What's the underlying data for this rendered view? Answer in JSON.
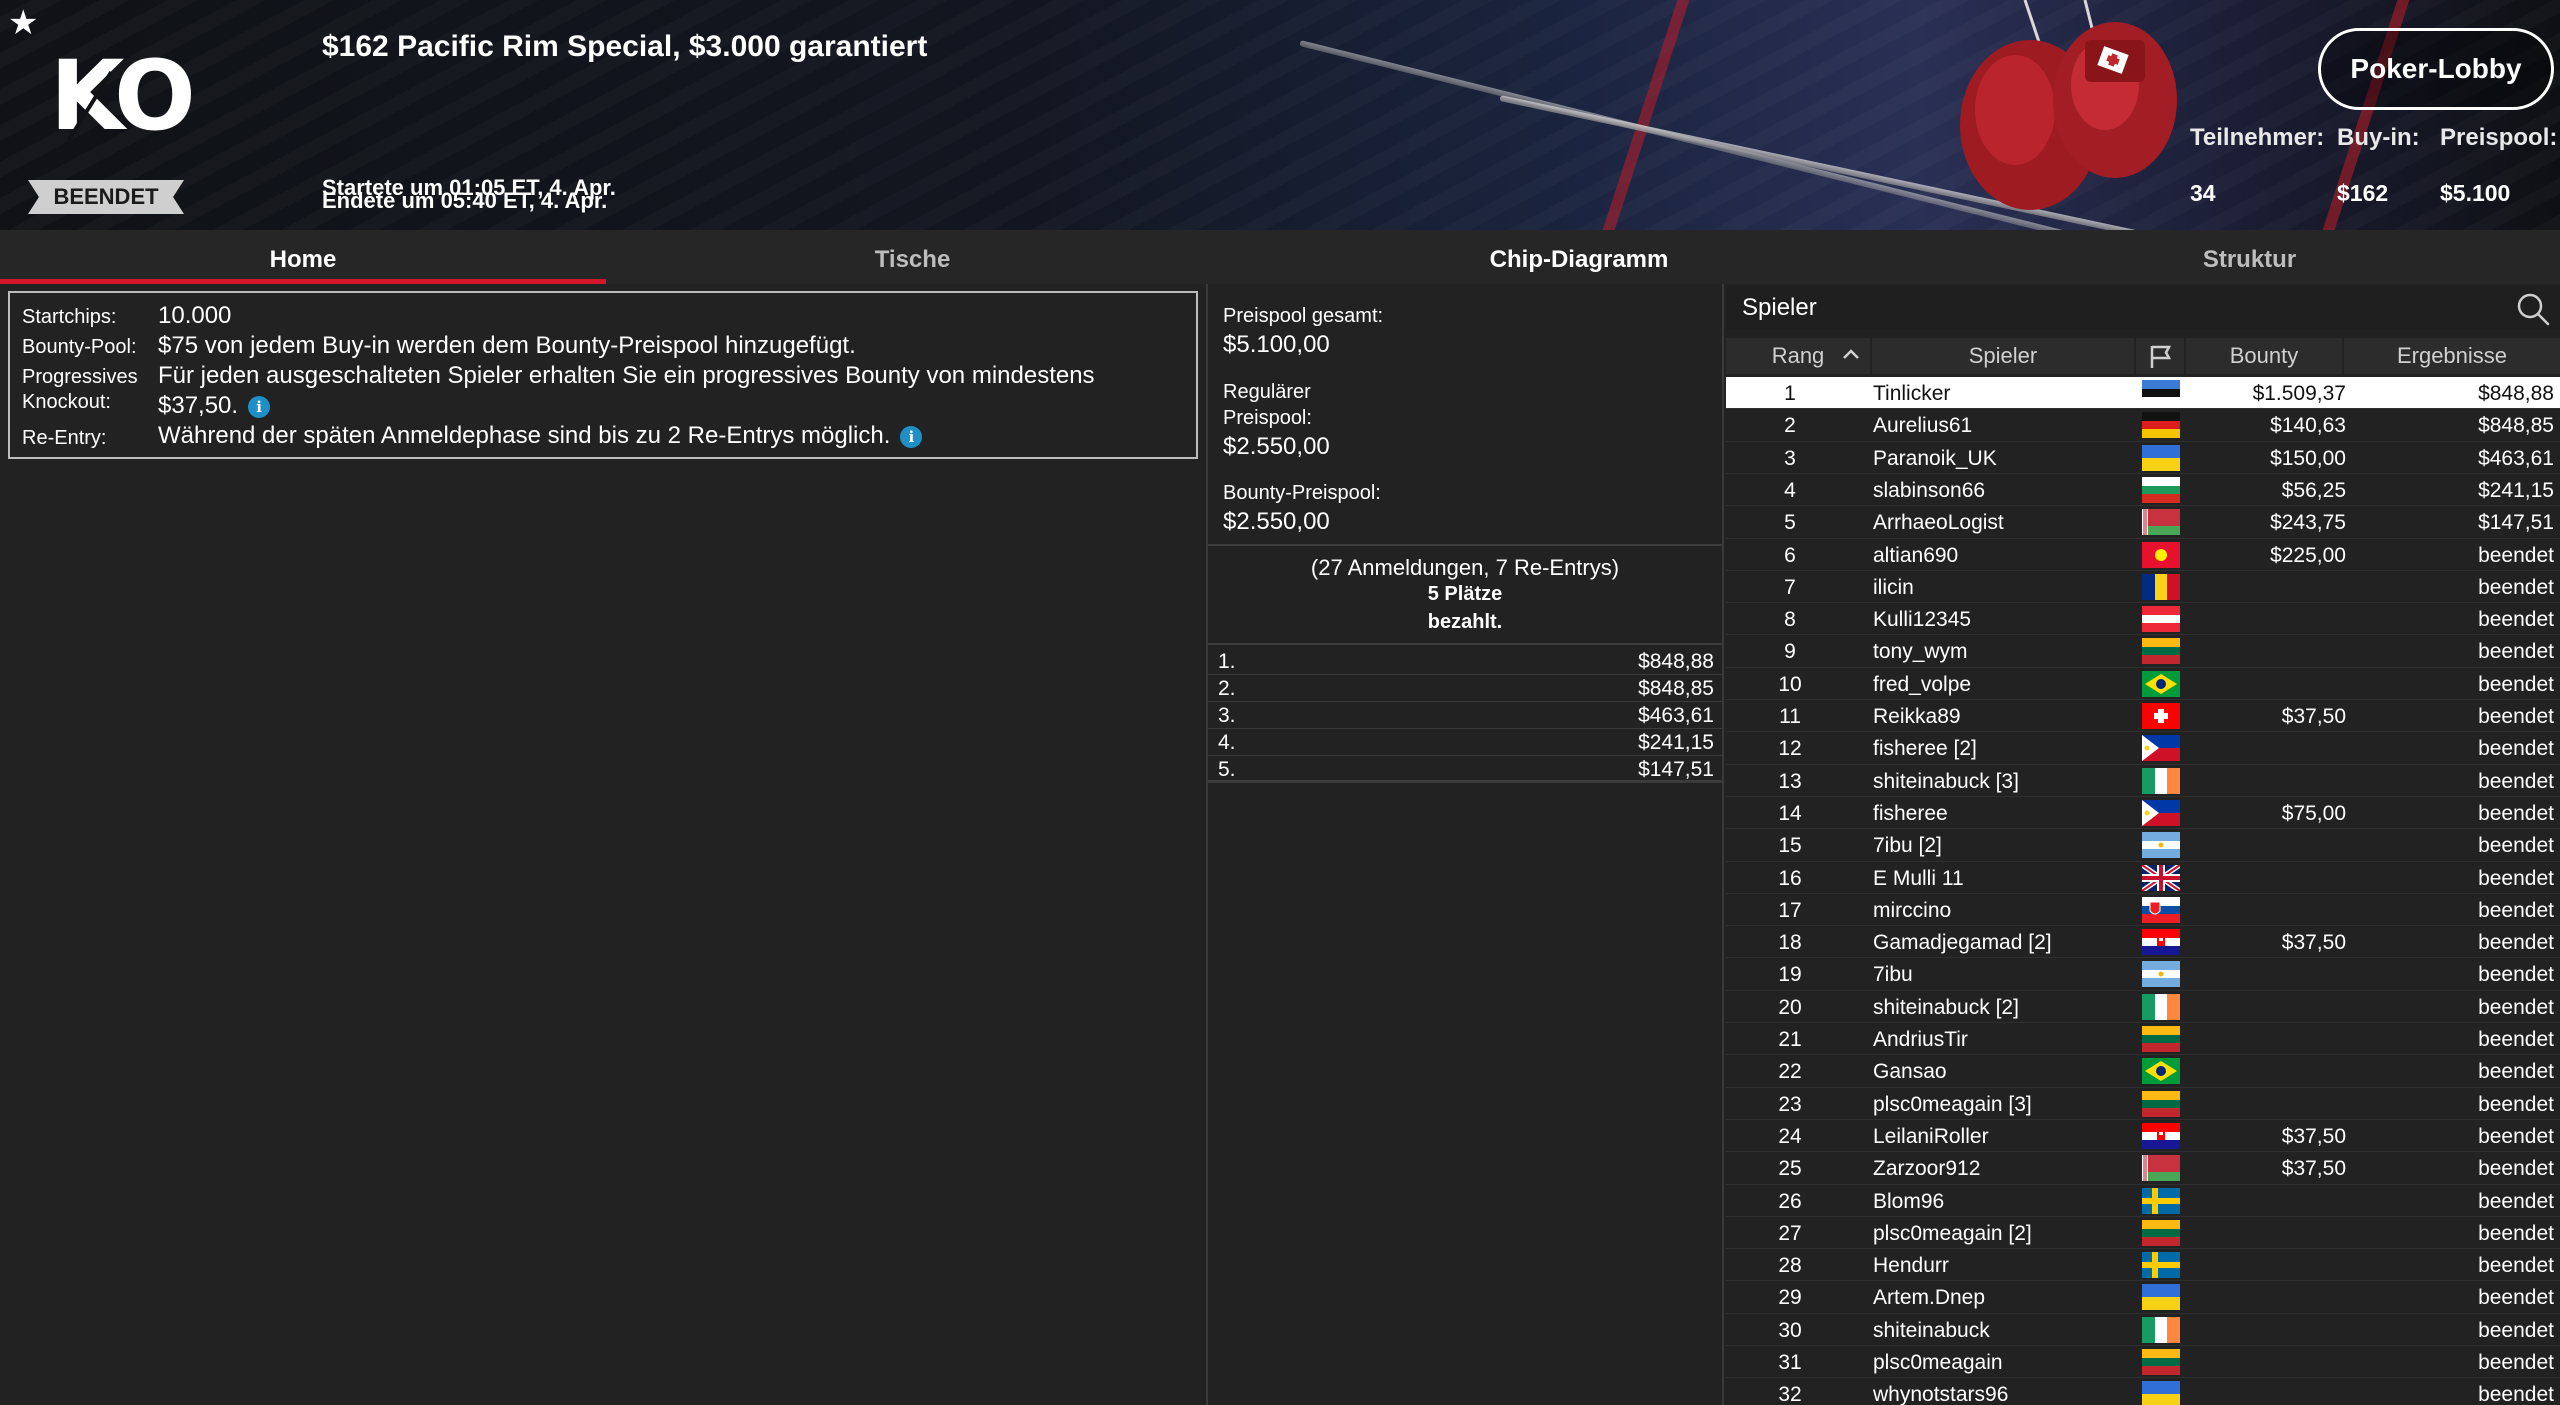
{
  "header": {
    "title": "$162 Pacific Rim Special, $3.000 garantiert",
    "logo": "KO",
    "status": "BEENDET",
    "started": "Startete um 01:05 ET, 4. Apr.",
    "ended": "Endete um 05:40 ET, 4. Apr.",
    "lobby_button": "Poker-Lobby",
    "stats": [
      {
        "label": "Teilnehmer:",
        "value": "34"
      },
      {
        "label": "Buy-in:",
        "value": "$162"
      },
      {
        "label": "Preispool:",
        "value": "$5.100"
      }
    ]
  },
  "tabs": [
    "Home",
    "Tische",
    "Chip-Diagramm",
    "Struktur"
  ],
  "info": {
    "startchips_label": "Startchips:",
    "startchips_value": "10.000",
    "bounty_label": "Bounty-Pool:",
    "bounty_value": "$75 von jedem Buy-in werden dem Bounty-Preispool hinzugefügt.",
    "progressive_label1": "Progressives",
    "progressive_label2": "Knockout:",
    "progressive_value1": "Für jeden ausgeschalteten Spieler erhalten Sie ein progressives Bounty von mindestens",
    "progressive_value2": "$37,50.",
    "reentry_label": "Re-Entry:",
    "reentry_value": "Während der späten Anmeldephase sind bis zu 2 Re-Entrys möglich.",
    "info_icon_glyph": "i"
  },
  "prize": {
    "total_label": "Preispool gesamt:",
    "total_value": "$5.100,00",
    "regular_label1": "Regulärer",
    "regular_label2": "Preispool:",
    "regular_value": "$2.550,00",
    "bounty_label": "Bounty-Preispool:",
    "bounty_value": "$2.550,00",
    "entries": "(27 Anmeldungen, 7 Re-Entrys)",
    "paid1": "5 Plätze",
    "paid2": "bezahlt.",
    "payouts": [
      {
        "place": "1.",
        "amount": "$848,88"
      },
      {
        "place": "2.",
        "amount": "$848,85"
      },
      {
        "place": "3.",
        "amount": "$463,61"
      },
      {
        "place": "4.",
        "amount": "$241,15"
      },
      {
        "place": "5.",
        "amount": "$147,51"
      }
    ]
  },
  "players": {
    "title": "Spieler",
    "columns": {
      "rank": "Rang",
      "player": "Spieler",
      "bounty": "Bounty",
      "result": "Ergebnisse"
    },
    "rows": [
      {
        "rank": "1",
        "name": "Tinlicker",
        "flag": "EE",
        "bounty": "$1.509,37",
        "result": "$848,88"
      },
      {
        "rank": "2",
        "name": "Aurelius61",
        "flag": "DE",
        "bounty": "$140,63",
        "result": "$848,85"
      },
      {
        "rank": "3",
        "name": "Paranoik_UK",
        "flag": "UA",
        "bounty": "$150,00",
        "result": "$463,61"
      },
      {
        "rank": "4",
        "name": "slabinson66",
        "flag": "BG",
        "bounty": "$56,25",
        "result": "$241,15"
      },
      {
        "rank": "5",
        "name": "ArrhaeoLogist",
        "flag": "BY",
        "bounty": "$243,75",
        "result": "$147,51"
      },
      {
        "rank": "6",
        "name": "altian690",
        "flag": "KG",
        "bounty": "$225,00",
        "result": "beendet"
      },
      {
        "rank": "7",
        "name": "ilicin",
        "flag": "RO",
        "bounty": "",
        "result": "beendet"
      },
      {
        "rank": "8",
        "name": "Kulli12345",
        "flag": "AT",
        "bounty": "",
        "result": "beendet"
      },
      {
        "rank": "9",
        "name": "tony_wym",
        "flag": "LT",
        "bounty": "",
        "result": "beendet"
      },
      {
        "rank": "10",
        "name": "fred_volpe",
        "flag": "BR",
        "bounty": "",
        "result": "beendet"
      },
      {
        "rank": "11",
        "name": "Reikka89",
        "flag": "CH",
        "bounty": "$37,50",
        "result": "beendet"
      },
      {
        "rank": "12",
        "name": "fisheree [2]",
        "flag": "PH",
        "bounty": "",
        "result": "beendet"
      },
      {
        "rank": "13",
        "name": "shiteinabuck [3]",
        "flag": "IE",
        "bounty": "",
        "result": "beendet"
      },
      {
        "rank": "14",
        "name": "fisheree",
        "flag": "PH",
        "bounty": "$75,00",
        "result": "beendet"
      },
      {
        "rank": "15",
        "name": "7ibu [2]",
        "flag": "AR",
        "bounty": "",
        "result": "beendet"
      },
      {
        "rank": "16",
        "name": "E Mulli 11",
        "flag": "GB",
        "bounty": "",
        "result": "beendet"
      },
      {
        "rank": "17",
        "name": "mirccino",
        "flag": "SK",
        "bounty": "",
        "result": "beendet"
      },
      {
        "rank": "18",
        "name": "Gamadjegamad [2]",
        "flag": "HR",
        "bounty": "$37,50",
        "result": "beendet"
      },
      {
        "rank": "19",
        "name": "7ibu",
        "flag": "AR",
        "bounty": "",
        "result": "beendet"
      },
      {
        "rank": "20",
        "name": "shiteinabuck [2]",
        "flag": "IE",
        "bounty": "",
        "result": "beendet"
      },
      {
        "rank": "21",
        "name": "AndriusTir",
        "flag": "LT",
        "bounty": "",
        "result": "beendet"
      },
      {
        "rank": "22",
        "name": "Gansao",
        "flag": "BR",
        "bounty": "",
        "result": "beendet"
      },
      {
        "rank": "23",
        "name": "plsc0meagain [3]",
        "flag": "LT",
        "bounty": "",
        "result": "beendet"
      },
      {
        "rank": "24",
        "name": "LeilaniRoller",
        "flag": "HR",
        "bounty": "$37,50",
        "result": "beendet"
      },
      {
        "rank": "25",
        "name": "Zarzoor912",
        "flag": "BY",
        "bounty": "$37,50",
        "result": "beendet"
      },
      {
        "rank": "26",
        "name": "Blom96",
        "flag": "SE",
        "bounty": "",
        "result": "beendet"
      },
      {
        "rank": "27",
        "name": "plsc0meagain [2]",
        "flag": "LT",
        "bounty": "",
        "result": "beendet"
      },
      {
        "rank": "28",
        "name": "Hendurr",
        "flag": "SE",
        "bounty": "",
        "result": "beendet"
      },
      {
        "rank": "29",
        "name": "Artem.Dnep",
        "flag": "UA",
        "bounty": "",
        "result": "beendet"
      },
      {
        "rank": "30",
        "name": "shiteinabuck",
        "flag": "IE",
        "bounty": "",
        "result": "beendet"
      },
      {
        "rank": "31",
        "name": "plsc0meagain",
        "flag": "LT",
        "bounty": "",
        "result": "beendet"
      },
      {
        "rank": "32",
        "name": "whynotstars96",
        "flag": "UA",
        "bounty": "",
        "result": "beendet"
      }
    ]
  },
  "colors": {
    "accent": "#d3172b",
    "info_icon": "#1f8fc8",
    "background": "#222222"
  }
}
